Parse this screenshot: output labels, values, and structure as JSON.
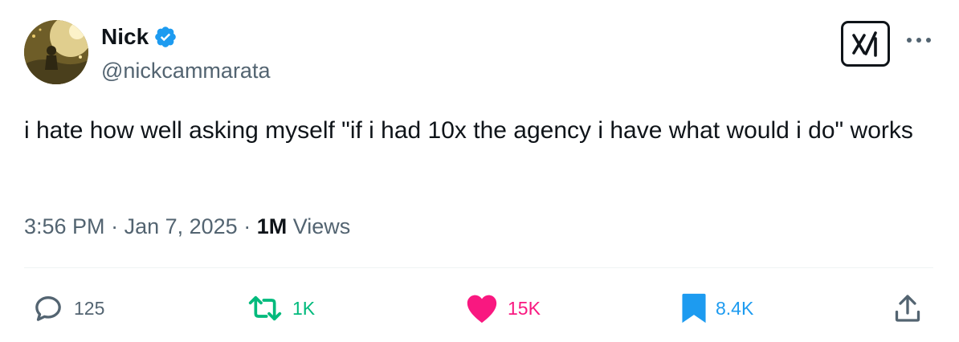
{
  "author": {
    "display_name": "Nick",
    "handle": "@nickcammarata",
    "verified": true,
    "verified_color": "#1d9bf0"
  },
  "header_icons": {
    "grok": "grok-icon",
    "more": "more-icon"
  },
  "tweet": {
    "text": "i hate how well asking myself \"if i had 10x the agency i have what would i do\" works"
  },
  "meta": {
    "time": "3:56 PM",
    "separator": " · ",
    "date": "Jan 7, 2025",
    "views_count": "1M",
    "views_label": " Views"
  },
  "actions": {
    "replies": "125",
    "reposts": "1K",
    "likes": "15K",
    "bookmarks": "8.4K"
  },
  "colors": {
    "text": "#0f1419",
    "secondary": "#536471",
    "repost": "#00ba7c",
    "like": "#f91880",
    "bookmark": "#1d9bf0",
    "divider": "#eff3f4"
  }
}
